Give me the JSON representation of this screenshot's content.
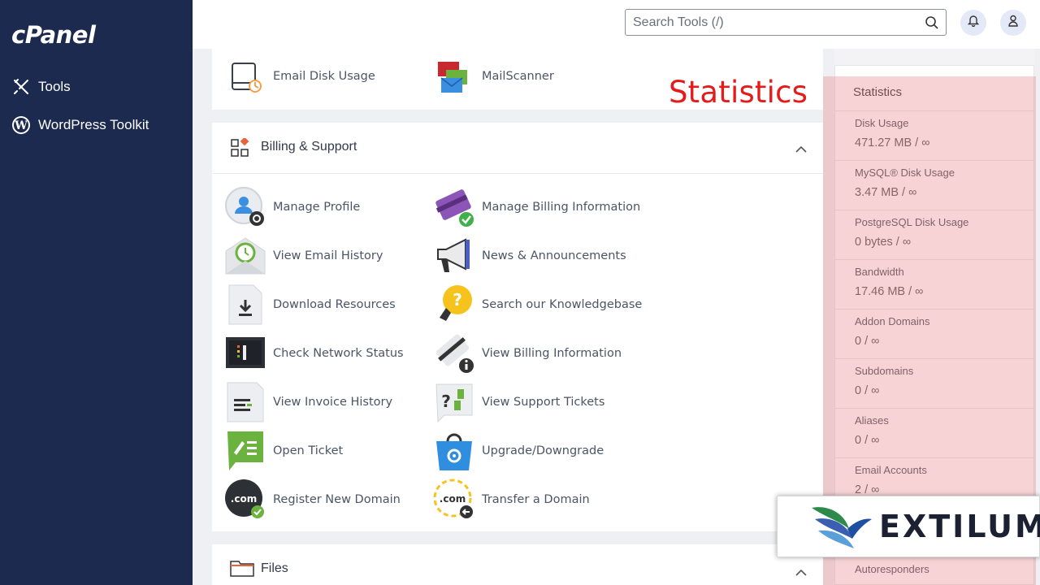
{
  "sidebar": {
    "logo": "cPanel",
    "items": [
      {
        "label": "Tools",
        "icon": "tools-icon"
      },
      {
        "label": "WordPress Toolkit",
        "icon": "wordpress-icon"
      }
    ]
  },
  "topbar": {
    "search_placeholder": "Search Tools (/)",
    "icons": [
      "search-icon",
      "bell-icon",
      "user-icon"
    ]
  },
  "email_section": {
    "tools": [
      {
        "label": "Email Disk Usage",
        "icon": "disk-drive-icon"
      },
      {
        "label": "MailScanner",
        "icon": "envelopes-icon"
      }
    ]
  },
  "billing_section": {
    "title": "Billing & Support",
    "tools": [
      {
        "label": "Manage Profile",
        "icon": "profile-gear-icon"
      },
      {
        "label": "Manage Billing Information",
        "icon": "credit-card-check-icon"
      },
      {
        "label": "View Email History",
        "icon": "envelope-clock-icon"
      },
      {
        "label": "News & Announcements",
        "icon": "megaphone-icon"
      },
      {
        "label": "Download Resources",
        "icon": "download-document-icon"
      },
      {
        "label": "Search our Knowledgebase",
        "icon": "lightbulb-question-icon"
      },
      {
        "label": "Check Network Status",
        "icon": "network-status-icon"
      },
      {
        "label": "View Billing Information",
        "icon": "card-info-icon"
      },
      {
        "label": "View Invoice History",
        "icon": "invoice-icon"
      },
      {
        "label": "View Support Tickets",
        "icon": "support-ticket-icon"
      },
      {
        "label": "Open Ticket",
        "icon": "open-ticket-icon"
      },
      {
        "label": "Upgrade/Downgrade",
        "icon": "shopping-bag-gear-icon"
      },
      {
        "label": "Register New Domain",
        "icon": "domain-register-icon"
      },
      {
        "label": "Transfer a Domain",
        "icon": "domain-transfer-icon"
      }
    ]
  },
  "files_section": {
    "title": "Files",
    "icon": "folder-icon"
  },
  "overlay_title": "Statistics",
  "stats": {
    "title": "Statistics",
    "rows": [
      {
        "label": "Disk Usage",
        "value": "471.27 MB / ∞"
      },
      {
        "label": "MySQL® Disk Usage",
        "value": "3.47 MB / ∞"
      },
      {
        "label": "PostgreSQL Disk Usage",
        "value": "0 bytes / ∞"
      },
      {
        "label": "Bandwidth",
        "value": "17.46 MB / ∞"
      },
      {
        "label": "Addon Domains",
        "value": "0 / ∞"
      },
      {
        "label": "Subdomains",
        "value": "0 / ∞"
      },
      {
        "label": "Aliases",
        "value": "0 / ∞"
      },
      {
        "label": "Email Accounts",
        "value": "2 / ∞"
      },
      {
        "label": "",
        "value": ""
      },
      {
        "label": "Autoresponders",
        "value": ""
      }
    ]
  },
  "watermark": {
    "text": "EXTILUM"
  },
  "colors": {
    "sidebar": "#1c2a4f",
    "highlight": "#e88088",
    "overlay_red": "#e31b1b"
  }
}
